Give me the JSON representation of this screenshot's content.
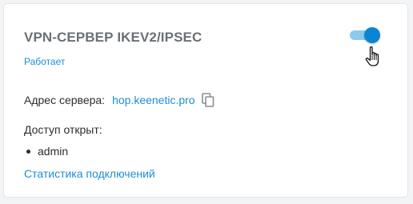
{
  "card": {
    "title": "VPN-СЕРВЕР IKEV2/IPSEC",
    "status": "Работает",
    "toggle": {
      "state": "on",
      "accent": "#0a85d6",
      "track": "#8cc9ef"
    },
    "server": {
      "label": "Адрес сервера:",
      "address": "hop.keenetic.pro",
      "copy_icon": "copy-icon"
    },
    "access": {
      "label": "Доступ открыт:",
      "users": [
        "admin"
      ]
    },
    "stats_link": "Статистика подключений"
  },
  "cursor": "hand-pointer-icon"
}
